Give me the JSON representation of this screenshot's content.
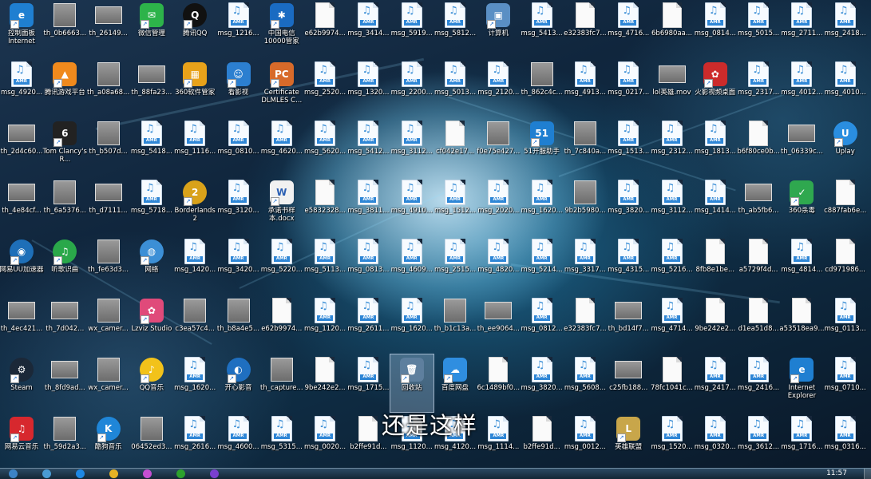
{
  "overlay_caption": "还是这样",
  "clock": "11:57",
  "taskbar": {
    "items": [
      {
        "name": "start-orb",
        "color": "#3d83c6"
      },
      {
        "name": "browser-icon",
        "color": "#4a9bd4"
      },
      {
        "name": "kugou-icon",
        "color": "#1e88e5"
      },
      {
        "name": "chrome-icon",
        "color": "#e7b325"
      },
      {
        "name": "color-wheel-icon",
        "color": "#c54fd2"
      },
      {
        "name": "iqiyi-icon",
        "color": "#2da12d"
      },
      {
        "name": "media-player-icon",
        "color": "#7a3fd0"
      }
    ]
  },
  "desktop": {
    "columns": 20,
    "rows": 8,
    "selected": [
      6,
      9
    ],
    "icons": [
      [
        {
          "label": "控制面板 Internet Explorer",
          "kind": "app",
          "color": "#1f7fd1",
          "glyph": "e",
          "two": true
        },
        {
          "label": "th_0b6663...",
          "kind": "photo"
        },
        {
          "label": "th_26149...",
          "kind": "photo-wide"
        },
        {
          "label": "微信管理",
          "kind": "app",
          "color": "#2db34a",
          "glyph": "✉"
        },
        {
          "label": "腾讯QQ",
          "kind": "app",
          "color": "#111111",
          "glyph": "Q",
          "round": true
        },
        {
          "label": "msg_1216...",
          "kind": "amr"
        },
        {
          "label": "中国电信10000管家",
          "kind": "app",
          "color": "#1a6bc2",
          "glyph": "✱",
          "two": true
        },
        {
          "label": "e62b9974...",
          "kind": "blank"
        },
        {
          "label": "msg_3414...",
          "kind": "amr"
        },
        {
          "label": "msg_5919...",
          "kind": "amr"
        },
        {
          "label": "msg_5812...",
          "kind": "amr"
        },
        {
          "label": "计算机",
          "kind": "app",
          "color": "#5a8fc4",
          "glyph": "▣"
        },
        {
          "label": "msg_5413...",
          "kind": "amr"
        },
        {
          "label": "e32383fc7...",
          "kind": "blank"
        },
        {
          "label": "msg_4716...",
          "kind": "amr"
        },
        {
          "label": "6b6980aa...",
          "kind": "blank"
        },
        {
          "label": "msg_0814...",
          "kind": "amr"
        },
        {
          "label": "msg_5015...",
          "kind": "amr"
        },
        {
          "label": "msg_2711...",
          "kind": "amr"
        },
        {
          "label": "msg_2418...",
          "kind": "amr"
        }
      ],
      [
        {
          "label": "msg_4920...",
          "kind": "amr"
        },
        {
          "label": "腾讯游戏平台",
          "kind": "app",
          "color": "#f08a1d",
          "glyph": "▲"
        },
        {
          "label": "th_a08a68...",
          "kind": "photo"
        },
        {
          "label": "th_88fa23...",
          "kind": "photo-wide"
        },
        {
          "label": "360软件管家",
          "kind": "app",
          "color": "#e8a21a",
          "glyph": "▦"
        },
        {
          "label": "看影视",
          "kind": "app",
          "color": "#2c7fd0",
          "glyph": "☺"
        },
        {
          "label": "Certificate DLMLES C...",
          "kind": "app",
          "color": "#d76a2a",
          "glyph": "PC",
          "two": true
        },
        {
          "label": "msg_2520...",
          "kind": "amr"
        },
        {
          "label": "msg_1320...",
          "kind": "amr"
        },
        {
          "label": "msg_2200...",
          "kind": "amr"
        },
        {
          "label": "msg_5013...",
          "kind": "amr"
        },
        {
          "label": "msg_2120...",
          "kind": "amr"
        },
        {
          "label": "th_862c4c...",
          "kind": "photo"
        },
        {
          "label": "msg_4913...",
          "kind": "amr"
        },
        {
          "label": "msg_0217...",
          "kind": "amr"
        },
        {
          "label": "lol英雄.mov",
          "kind": "photo-wide"
        },
        {
          "label": "火影视频桌面",
          "kind": "app",
          "color": "#cc2b2b",
          "glyph": "✿"
        },
        {
          "label": "msg_2317...",
          "kind": "amr"
        },
        {
          "label": "msg_4012...",
          "kind": "amr"
        },
        {
          "label": "msg_4010...",
          "kind": "amr"
        }
      ],
      [
        {
          "label": "th_2d4c60...",
          "kind": "photo-wide"
        },
        {
          "label": "Tom Clancy's R...",
          "kind": "app",
          "color": "#222222",
          "glyph": "6",
          "two": true
        },
        {
          "label": "th_b507d...",
          "kind": "photo"
        },
        {
          "label": "msg_5418...",
          "kind": "amr"
        },
        {
          "label": "msg_1116...",
          "kind": "amr"
        },
        {
          "label": "msg_0810...",
          "kind": "amr"
        },
        {
          "label": "msg_4620...",
          "kind": "amr"
        },
        {
          "label": "msg_5620...",
          "kind": "amr"
        },
        {
          "label": "msg_5412...",
          "kind": "amr"
        },
        {
          "label": "msg_3112...",
          "kind": "amr"
        },
        {
          "label": "cf042e17...",
          "kind": "blank"
        },
        {
          "label": "f0e75e427...",
          "kind": "photo"
        },
        {
          "label": "51开服助手",
          "kind": "app",
          "color": "#1f7fd1",
          "glyph": "51"
        },
        {
          "label": "th_7c840a...",
          "kind": "photo"
        },
        {
          "label": "msg_1513...",
          "kind": "amr"
        },
        {
          "label": "msg_2312...",
          "kind": "amr"
        },
        {
          "label": "msg_1813...",
          "kind": "amr"
        },
        {
          "label": "b6f80ce0b...",
          "kind": "blank"
        },
        {
          "label": "th_06339c...",
          "kind": "photo-wide"
        },
        {
          "label": "Uplay",
          "kind": "app",
          "color": "#2a8ee0",
          "glyph": "U",
          "round": true
        }
      ],
      [
        {
          "label": "th_4e84cf...",
          "kind": "photo-wide"
        },
        {
          "label": "th_6a5376...",
          "kind": "photo"
        },
        {
          "label": "th_d7111...",
          "kind": "photo-wide"
        },
        {
          "label": "msg_5718...",
          "kind": "amr"
        },
        {
          "label": "Borderlands 2",
          "kind": "app",
          "color": "#d9a21a",
          "glyph": "2",
          "round": true,
          "two": true
        },
        {
          "label": "msg_3120...",
          "kind": "amr"
        },
        {
          "label": "承诺书样本.docx",
          "kind": "app",
          "color": "#f1f1f1",
          "glyph": "W",
          "two": true
        },
        {
          "label": "e5832328...",
          "kind": "blank"
        },
        {
          "label": "msg_3811...",
          "kind": "amr"
        },
        {
          "label": "msg_4910...",
          "kind": "amr"
        },
        {
          "label": "msg_1512...",
          "kind": "amr"
        },
        {
          "label": "msg_2020...",
          "kind": "amr"
        },
        {
          "label": "msg_1620...",
          "kind": "amr"
        },
        {
          "label": "9b2b5980...",
          "kind": "photo"
        },
        {
          "label": "msg_3820...",
          "kind": "amr"
        },
        {
          "label": "msg_3112...",
          "kind": "amr"
        },
        {
          "label": "msg_1414...",
          "kind": "amr"
        },
        {
          "label": "th_ab5fb6...",
          "kind": "photo-wide"
        },
        {
          "label": "360杀毒",
          "kind": "app",
          "color": "#2fa84f",
          "glyph": "✓"
        },
        {
          "label": "c887fab6e...",
          "kind": "blank"
        }
      ],
      [
        {
          "label": "网易UU加速器",
          "kind": "app",
          "color": "#1e6fb8",
          "glyph": "◉",
          "round": true,
          "two": true
        },
        {
          "label": "听歌识曲",
          "kind": "app",
          "color": "#2aa84a",
          "glyph": "♫",
          "round": true
        },
        {
          "label": "th_fe63d3...",
          "kind": "photo"
        },
        {
          "label": "网络",
          "kind": "app",
          "color": "#3c8fd6",
          "glyph": "◍",
          "round": true
        },
        {
          "label": "msg_1420...",
          "kind": "amr"
        },
        {
          "label": "msg_3420...",
          "kind": "amr"
        },
        {
          "label": "msg_5220...",
          "kind": "amr"
        },
        {
          "label": "msg_5113...",
          "kind": "amr"
        },
        {
          "label": "msg_0813...",
          "kind": "amr"
        },
        {
          "label": "msg_4609...",
          "kind": "amr"
        },
        {
          "label": "msg_2515...",
          "kind": "amr"
        },
        {
          "label": "msg_4820...",
          "kind": "amr"
        },
        {
          "label": "msg_5214...",
          "kind": "amr"
        },
        {
          "label": "msg_3317...",
          "kind": "amr"
        },
        {
          "label": "msg_4315...",
          "kind": "amr"
        },
        {
          "label": "msg_5216...",
          "kind": "amr"
        },
        {
          "label": "8fb8e1be...",
          "kind": "blank"
        },
        {
          "label": "a5729f4d...",
          "kind": "blank"
        },
        {
          "label": "msg_4814...",
          "kind": "amr"
        },
        {
          "label": "cd971986...",
          "kind": "blank"
        }
      ],
      [
        {
          "label": "th_4ec421...",
          "kind": "photo-wide"
        },
        {
          "label": "th_7d042...",
          "kind": "photo-wide"
        },
        {
          "label": "wx_camer...",
          "kind": "photo"
        },
        {
          "label": "Lzviz Studio",
          "kind": "app",
          "color": "#e04a7a",
          "glyph": "✿"
        },
        {
          "label": "c3ea57c4...",
          "kind": "photo"
        },
        {
          "label": "th_b8a4e5...",
          "kind": "photo"
        },
        {
          "label": "e62b9974...",
          "kind": "blank"
        },
        {
          "label": "msg_1120...",
          "kind": "amr"
        },
        {
          "label": "msg_2611...",
          "kind": "amr"
        },
        {
          "label": "msg_1620...",
          "kind": "amr"
        },
        {
          "label": "th_b1c13a...",
          "kind": "photo"
        },
        {
          "label": "th_ee9064...",
          "kind": "photo-wide"
        },
        {
          "label": "msg_0812...",
          "kind": "amr"
        },
        {
          "label": "e32383fc7...",
          "kind": "blank"
        },
        {
          "label": "th_bd14f7...",
          "kind": "photo-wide"
        },
        {
          "label": "msg_4714...",
          "kind": "amr"
        },
        {
          "label": "9be242e2...",
          "kind": "blank"
        },
        {
          "label": "d1ea51d8...",
          "kind": "blank"
        },
        {
          "label": "a53518ea9...",
          "kind": "blank"
        },
        {
          "label": "msg_0113...",
          "kind": "amr"
        }
      ],
      [
        {
          "label": "Steam",
          "kind": "app",
          "color": "#1b2838",
          "glyph": "⚙",
          "round": true
        },
        {
          "label": "th_8fd9ad...",
          "kind": "photo-wide"
        },
        {
          "label": "wx_camer...",
          "kind": "photo"
        },
        {
          "label": "QQ音乐",
          "kind": "app",
          "color": "#f2c21a",
          "glyph": "♪",
          "round": true
        },
        {
          "label": "msg_1620...",
          "kind": "amr"
        },
        {
          "label": "开心影音",
          "kind": "app",
          "color": "#1f6fc0",
          "glyph": "◐",
          "round": true
        },
        {
          "label": "th_capture...",
          "kind": "photo"
        },
        {
          "label": "9be242e2...",
          "kind": "blank"
        },
        {
          "label": "msg_1715...",
          "kind": "amr"
        },
        {
          "label": "回收站",
          "kind": "app",
          "color": "#5e7f9e",
          "glyph": "🗑"
        },
        {
          "label": "百度网盘",
          "kind": "app",
          "color": "#2f8ee0",
          "glyph": "☁"
        },
        {
          "label": "6c1489bf0...",
          "kind": "blank"
        },
        {
          "label": "msg_3820...",
          "kind": "amr"
        },
        {
          "label": "msg_5608...",
          "kind": "amr"
        },
        {
          "label": "c25fb188...",
          "kind": "photo-wide"
        },
        {
          "label": "78fc1041c...",
          "kind": "blank"
        },
        {
          "label": "msg_2417...",
          "kind": "amr"
        },
        {
          "label": "msg_2416...",
          "kind": "amr"
        },
        {
          "label": "Internet Explorer",
          "kind": "app",
          "color": "#1f7fd1",
          "glyph": "e",
          "two": true
        },
        {
          "label": "msg_0710...",
          "kind": "amr"
        }
      ],
      [
        {
          "label": "网易云音乐",
          "kind": "app",
          "color": "#d7282e",
          "glyph": "♫"
        },
        {
          "label": "th_59d2a3...",
          "kind": "photo"
        },
        {
          "label": "酷狗音乐",
          "kind": "app",
          "color": "#1f86d8",
          "glyph": "K",
          "round": true
        },
        {
          "label": "06452ed3...",
          "kind": "photo"
        },
        {
          "label": "msg_2616...",
          "kind": "amr"
        },
        {
          "label": "msg_4600...",
          "kind": "amr"
        },
        {
          "label": "msg_5315...",
          "kind": "amr"
        },
        {
          "label": "msg_0020...",
          "kind": "amr"
        },
        {
          "label": "b2ffe91d...",
          "kind": "blank"
        },
        {
          "label": "msg_1120...",
          "kind": "amr"
        },
        {
          "label": "msg_4120...",
          "kind": "amr"
        },
        {
          "label": "msg_1114...",
          "kind": "amr"
        },
        {
          "label": "b2ffe91d...",
          "kind": "blank"
        },
        {
          "label": "msg_0012...",
          "kind": "amr"
        },
        {
          "label": "英雄联盟",
          "kind": "app",
          "color": "#c8a64a",
          "glyph": "L"
        },
        {
          "label": "msg_1520...",
          "kind": "amr"
        },
        {
          "label": "msg_0320...",
          "kind": "amr"
        },
        {
          "label": "msg_3612...",
          "kind": "amr"
        },
        {
          "label": "msg_1716...",
          "kind": "amr"
        },
        {
          "label": "msg_0316...",
          "kind": "amr"
        }
      ]
    ]
  }
}
